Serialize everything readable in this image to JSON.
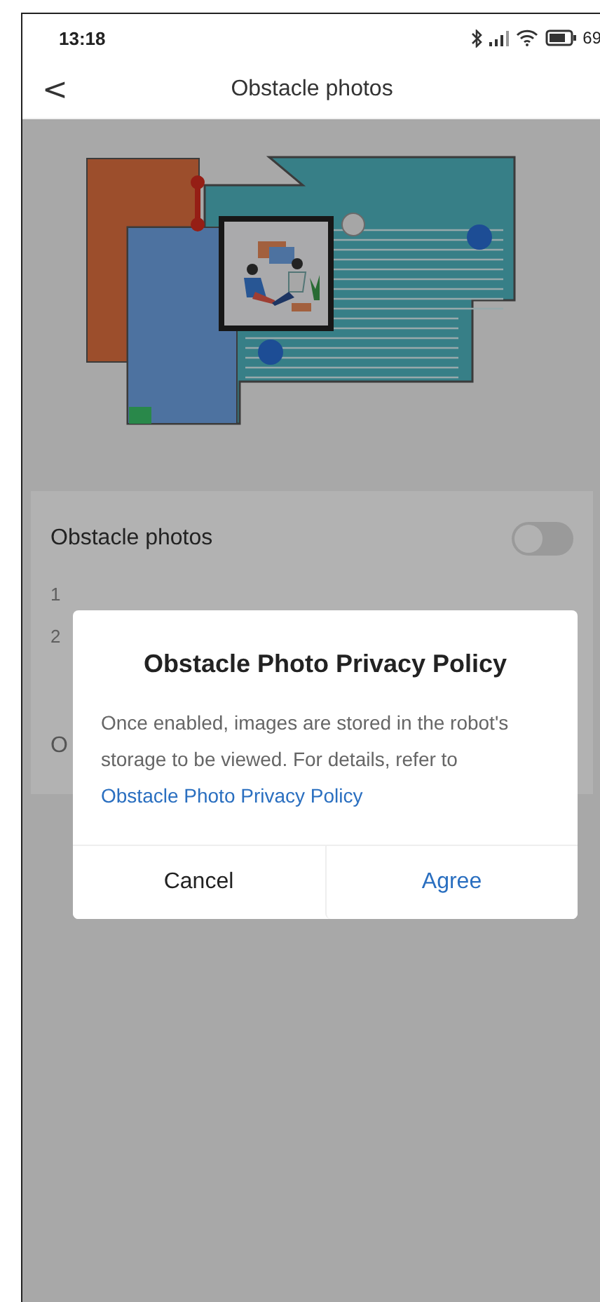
{
  "status_bar": {
    "time": "13:18",
    "battery": "69"
  },
  "header": {
    "back": "<",
    "title": "Obstacle photos"
  },
  "settings": [
    {
      "kind": "toggle",
      "label": "Obstacle photos",
      "on": false
    },
    {
      "kind": "note",
      "label": "1"
    },
    {
      "kind": "note",
      "label": "2"
    },
    {
      "kind": "link",
      "label": "O"
    }
  ],
  "dialog": {
    "title": "Obstacle Photo Privacy Policy",
    "body": "Once enabled, images are stored in the robot's storage to be viewed. For details, refer to",
    "link": "Obstacle Photo Privacy Policy",
    "buttons": [
      "Cancel",
      "Agree"
    ]
  }
}
